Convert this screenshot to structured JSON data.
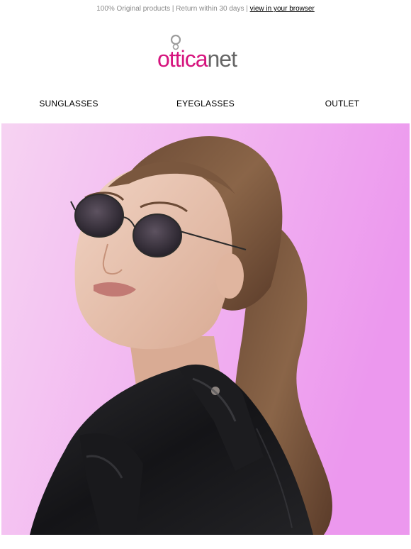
{
  "preheader": {
    "text": "100% Original products | Return within 30 days | ",
    "link_label": "view in your browser"
  },
  "logo": {
    "pink_text": "ottica",
    "gray_text": "net",
    "pink_color": "#d6147e",
    "gray_color": "#666666"
  },
  "nav": {
    "items": [
      {
        "label": "SUNGLASSES"
      },
      {
        "label": "EYEGLASSES"
      },
      {
        "label": "OUTLET"
      }
    ]
  },
  "hero": {
    "description_icon": "model-wearing-sunglasses-photo",
    "background_colors": [
      "#f3c6f0",
      "#ef9df0"
    ]
  }
}
